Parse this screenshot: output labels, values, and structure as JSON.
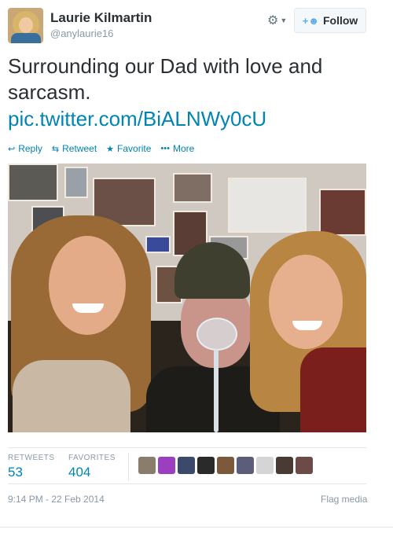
{
  "user": {
    "name": "Laurie Kilmartin",
    "handle": "@anylaurie16",
    "avatar_icon": "user-avatar"
  },
  "header": {
    "gear_icon": "gear-icon",
    "follow_label": "Follow",
    "follow_icon": "add-user-icon"
  },
  "tweet": {
    "text": "Surrounding our Dad with love and sarcasm.",
    "link": "pic.twitter.com/BiALNWy0cU"
  },
  "actions": [
    {
      "label": "Reply",
      "icon": "reply-icon"
    },
    {
      "label": "Retweet",
      "icon": "retweet-icon"
    },
    {
      "label": "Favorite",
      "icon": "star-icon"
    },
    {
      "label": "More",
      "icon": "more-dots-icon"
    }
  ],
  "stats": {
    "retweets_label": "RETWEETS",
    "retweets_value": "53",
    "favorites_label": "FAVORITES",
    "favorites_value": "404"
  },
  "footer": {
    "timestamp": "9:14 PM - 22 Feb 2014",
    "flag_label": "Flag media"
  },
  "colors": {
    "link": "#0084b4",
    "muted": "#8899a6",
    "accent": "#55acee"
  }
}
